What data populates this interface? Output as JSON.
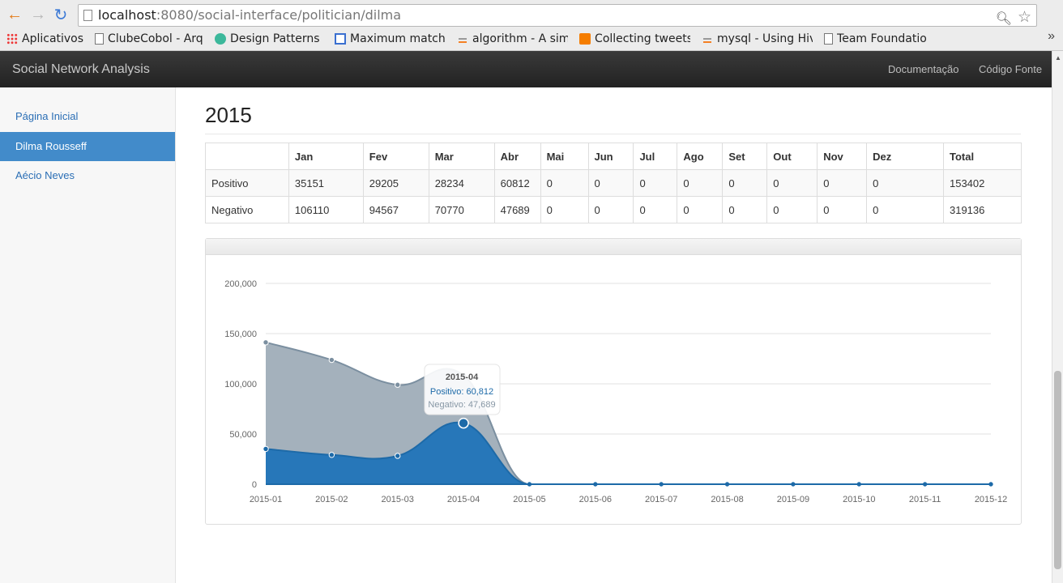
{
  "browser": {
    "url_host": "localhost",
    "url_path": ":8080/social-interface/politician/dilma",
    "bookmarks": [
      {
        "label": "Aplicativos",
        "icon": "apps-grid-icon"
      },
      {
        "label": "ClubeCobol - Arqu",
        "icon": "document-icon"
      },
      {
        "label": "Design Patterns &",
        "icon": "green-circle-icon"
      },
      {
        "label": "Maximum matchin",
        "icon": "blue-square-icon"
      },
      {
        "label": "algorithm - A simpl",
        "icon": "stackoverflow-icon"
      },
      {
        "label": "Collecting tweets",
        "icon": "blogger-icon"
      },
      {
        "label": "mysql - Using Hive",
        "icon": "stackoverflow-icon"
      },
      {
        "label": "Team Foundation V",
        "icon": "document-icon"
      }
    ],
    "more": "»"
  },
  "navbar": {
    "brand": "Social Network Analysis",
    "links": [
      "Documentação",
      "Código Fonte"
    ]
  },
  "sidebar": {
    "items": [
      {
        "label": "Página Inicial",
        "active": false
      },
      {
        "label": "Dilma Rousseff",
        "active": true
      },
      {
        "label": "Aécio Neves",
        "active": false
      }
    ]
  },
  "main": {
    "year": "2015",
    "table": {
      "headers": [
        "",
        "Jan",
        "Fev",
        "Mar",
        "Abr",
        "Mai",
        "Jun",
        "Jul",
        "Ago",
        "Set",
        "Out",
        "Nov",
        "Dez",
        "Total"
      ],
      "rows": [
        [
          "Positivo",
          "35151",
          "29205",
          "28234",
          "60812",
          "0",
          "0",
          "0",
          "0",
          "0",
          "0",
          "0",
          "0",
          "153402"
        ],
        [
          "Negativo",
          "106110",
          "94567",
          "70770",
          "47689",
          "0",
          "0",
          "0",
          "0",
          "0",
          "0",
          "0",
          "0",
          "319136"
        ]
      ]
    }
  },
  "chart_data": {
    "type": "area",
    "x": [
      "2015-01",
      "2015-02",
      "2015-03",
      "2015-04",
      "2015-05",
      "2015-06",
      "2015-07",
      "2015-08",
      "2015-09",
      "2015-10",
      "2015-11",
      "2015-12"
    ],
    "series": [
      {
        "name": "Negativo",
        "values": [
          141261,
          123772,
          99004,
          108501,
          0,
          0,
          0,
          0,
          0,
          0,
          0,
          0
        ],
        "color": "#a4b1bc",
        "line_color": "#7b8fa0"
      },
      {
        "name": "Positivo",
        "values": [
          35151,
          29205,
          28234,
          60812,
          0,
          0,
          0,
          0,
          0,
          0,
          0,
          0
        ],
        "color": "#2777b9",
        "line_color": "#1d6aa8"
      }
    ],
    "stacked": true,
    "ylim": [
      0,
      200000
    ],
    "yticks": [
      0,
      50000,
      100000,
      150000,
      200000
    ],
    "ytick_labels": [
      "0",
      "50,000",
      "100,000",
      "150,000",
      "200,000"
    ],
    "grid": true,
    "tooltip": {
      "title": "2015-04",
      "lines": [
        "Positivo: 60,812",
        "Negativo: 47,689"
      ]
    }
  }
}
